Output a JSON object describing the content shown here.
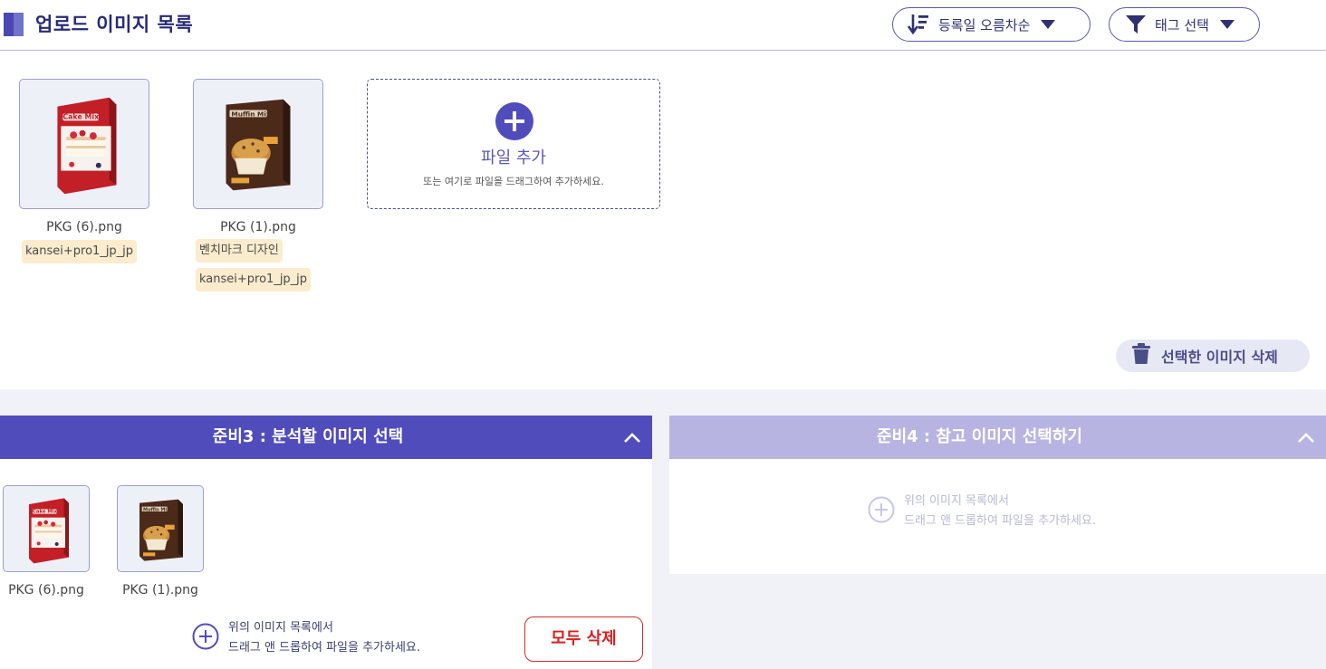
{
  "header": {
    "title": "업로드 이미지 목록",
    "sort_label": "등록일 오름차순",
    "tag_filter_label": "태그 선택"
  },
  "images": [
    {
      "filename": "PKG (6).png",
      "tags": [
        "kansei+pro1_jp_jp"
      ],
      "product": "cake-mix",
      "box_text": "Cake Mix"
    },
    {
      "filename": "PKG (1).png",
      "tags": [
        "벤치마크 디자인",
        "kansei+pro1_jp_jp"
      ],
      "product": "muffin-mix",
      "box_text": "Muffin Mix"
    }
  ],
  "dropzone": {
    "title": "파일 추가",
    "subtitle": "또는 여기로 파일을 드래그하여 추가하세요."
  },
  "delete_selected_label": "선택한 이미지 삭제",
  "step3": {
    "title": "준비3 : 분석할 이미지 선택",
    "items": [
      {
        "filename": "PKG (6).png"
      },
      {
        "filename": "PKG (1).png"
      }
    ],
    "hint_line1": "위의 이미지 목록에서",
    "hint_line2": "드래그 앤 드롭하여 파일을 추가하세요.",
    "clear_all_label": "모두 삭제"
  },
  "step4": {
    "title": "준비4 : 참고 이미지 선택하기",
    "hint_line1": "위의 이미지 목록에서",
    "hint_line2": "드래그 앤 드롭하여 파일을 추가하세요."
  },
  "colors": {
    "primary": "#514cbc",
    "primary_light": "#b7b4e2",
    "title": "#282a7a",
    "tag_bg": "#fbeccd",
    "danger": "#d91f1f"
  }
}
